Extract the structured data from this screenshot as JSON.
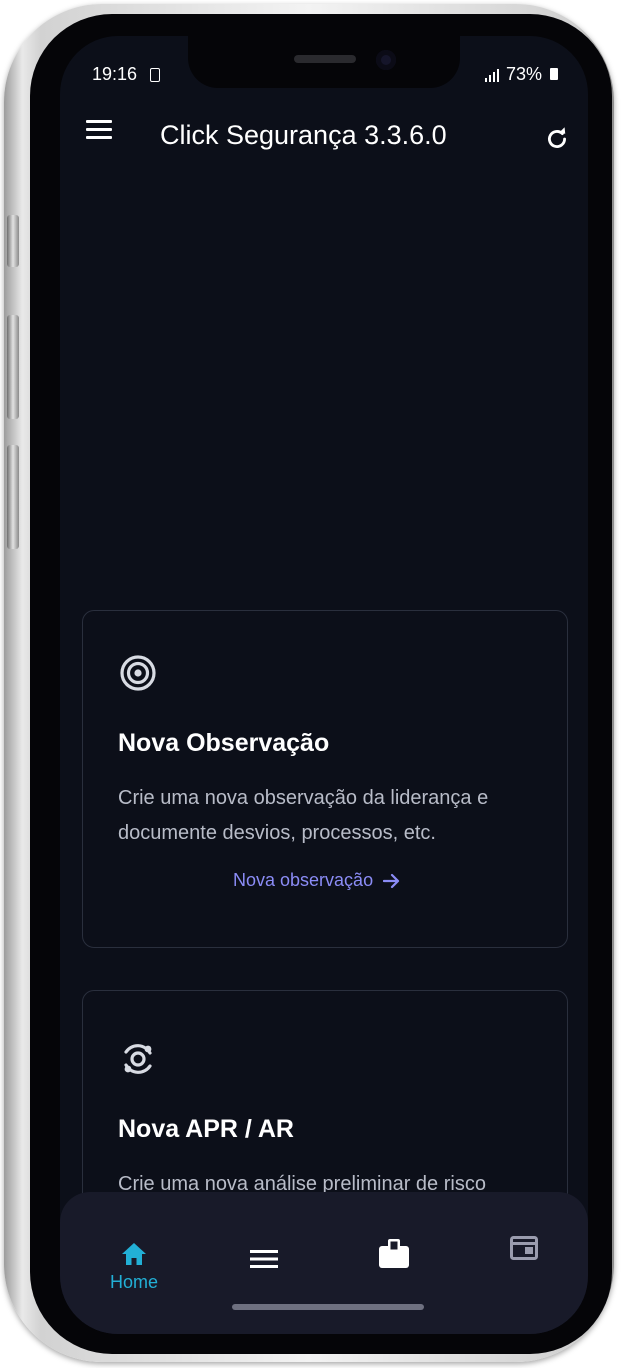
{
  "status_bar": {
    "time": "19:16",
    "battery": "73%"
  },
  "app_bar": {
    "title": "Click Segurança 3.3.6.0",
    "menu_icon": "hamburger-menu-icon",
    "refresh_icon": "refresh-icon"
  },
  "cards": [
    {
      "icon": "target-icon",
      "title": "Nova Observação",
      "description": "Crie uma nova observação da liderança e documente desvios, processos, etc.",
      "link": "Nova observação"
    },
    {
      "icon": "orbit-icon",
      "title": "Nova APR / AR",
      "description": "Crie uma nova análise preliminar de risco"
    }
  ],
  "bottom_nav": {
    "items": [
      {
        "icon": "home-icon",
        "label": "Home",
        "active": true
      },
      {
        "icon": "list-icon",
        "label": ""
      },
      {
        "icon": "briefcase-icon",
        "label": ""
      },
      {
        "icon": "window-icon",
        "label": ""
      }
    ]
  },
  "colors": {
    "background": "#0c0f19",
    "accent": "#22b0d6",
    "link": "#8b8cf6",
    "card_border": "#2a2f3d"
  }
}
